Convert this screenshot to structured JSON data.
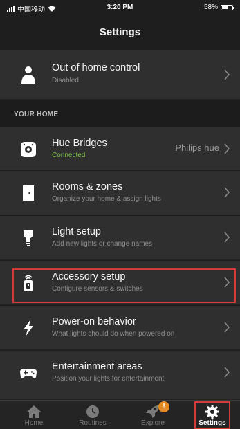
{
  "status_bar": {
    "carrier": "中国移动",
    "time": "3:20 PM",
    "battery": "58%",
    "battery_level": 0.58
  },
  "header": {
    "title": "Settings"
  },
  "top_row": {
    "title": "Out of home control",
    "subtitle": "Disabled",
    "icon": "person-icon"
  },
  "section": {
    "title": "YOUR HOME"
  },
  "items": [
    {
      "title": "Hue Bridges",
      "subtitle": "Connected",
      "value": "Philips hue",
      "icon": "bridge-icon"
    },
    {
      "title": "Rooms & zones",
      "subtitle": "Organize your home & assign lights",
      "icon": "door-icon"
    },
    {
      "title": "Light setup",
      "subtitle": "Add new lights or change names",
      "icon": "bulb-icon"
    },
    {
      "title": "Accessory setup",
      "subtitle": "Configure sensors & switches",
      "icon": "remote-icon"
    },
    {
      "title": "Power-on behavior",
      "subtitle": "What lights should do when powered on",
      "icon": "lightning-icon"
    },
    {
      "title": "Entertainment areas",
      "subtitle": "Position your lights for entertainment",
      "icon": "gamepad-icon"
    }
  ],
  "tabs": [
    {
      "label": "Home",
      "icon": "home-icon"
    },
    {
      "label": "Routines",
      "icon": "clock-icon"
    },
    {
      "label": "Explore",
      "icon": "rocket-icon",
      "badge": "!"
    },
    {
      "label": "Settings",
      "icon": "gear-icon",
      "active": true
    }
  ],
  "colors": {
    "background": "#1c1c1c",
    "row": "#2f2f2f",
    "connected": "#7fc244",
    "highlight": "#d33a3a",
    "badge": "#e58b24"
  }
}
